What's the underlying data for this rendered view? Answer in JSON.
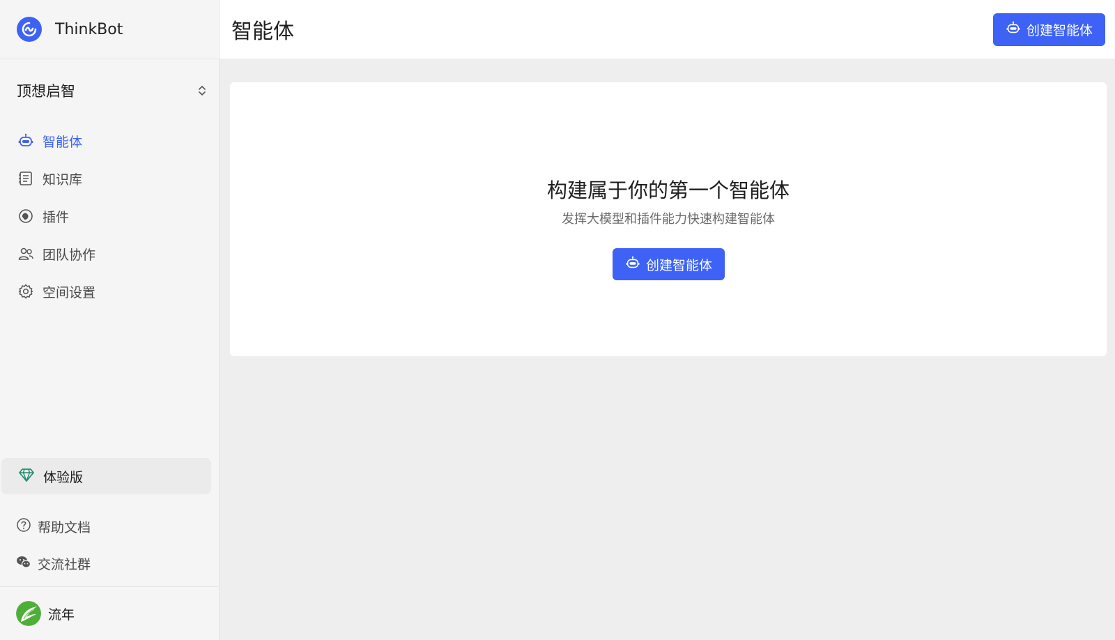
{
  "app": {
    "name": "ThinkBot"
  },
  "workspace": {
    "name": "顶想启智"
  },
  "nav": {
    "items": [
      {
        "label": "智能体",
        "icon": "robot-icon",
        "active": true
      },
      {
        "label": "知识库",
        "icon": "book-icon"
      },
      {
        "label": "插件",
        "icon": "plugin-icon"
      },
      {
        "label": "团队协作",
        "icon": "team-icon"
      },
      {
        "label": "空间设置",
        "icon": "gear-icon"
      }
    ]
  },
  "plan": {
    "label": "体验版",
    "icon": "diamond-icon"
  },
  "links": [
    {
      "label": "帮助文档",
      "icon": "question-circle-icon"
    },
    {
      "label": "交流社群",
      "icon": "wechat-icon"
    }
  ],
  "user": {
    "name": "流年"
  },
  "header": {
    "title": "智能体",
    "create_label": "创建智能体"
  },
  "empty": {
    "title": "构建属于你的第一个智能体",
    "subtitle": "发挥大模型和插件能力快速构建智能体",
    "create_label": "创建智能体"
  },
  "colors": {
    "accent": "#3d62f5",
    "background": "#eeeeee",
    "sidebar": "#f5f5f5"
  }
}
